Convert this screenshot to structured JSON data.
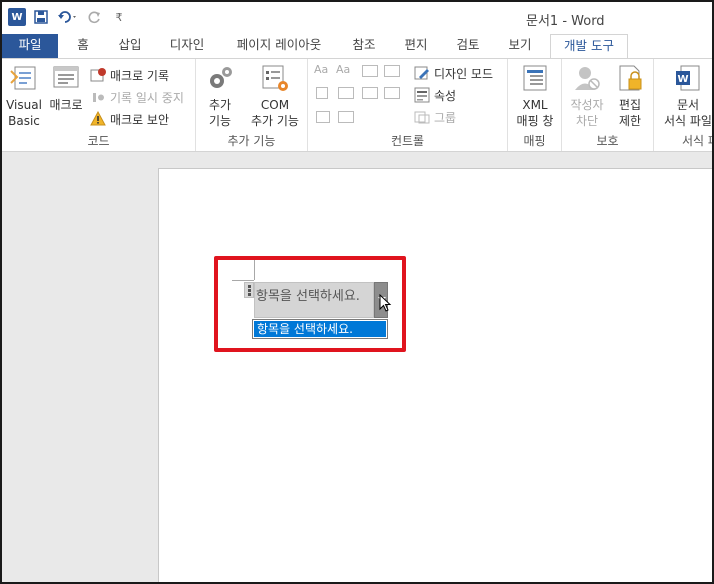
{
  "window": {
    "title": "문서1 - Word"
  },
  "qat": {
    "redo_more": "₹"
  },
  "tabs": [
    {
      "label": "파일"
    },
    {
      "label": "홈"
    },
    {
      "label": "삽입"
    },
    {
      "label": "디자인"
    },
    {
      "label": "페이지 레이아웃"
    },
    {
      "label": "참조"
    },
    {
      "label": "편지"
    },
    {
      "label": "검토"
    },
    {
      "label": "보기"
    },
    {
      "label": "개발 도구"
    }
  ],
  "ribbon": {
    "code": {
      "label": "코드",
      "visual_basic_1": "Visual",
      "visual_basic_2": "Basic",
      "macro": "매크로",
      "record_macro": "매크로 기록",
      "pause_recording": "기록 일시 중지",
      "macro_security": "매크로 보안"
    },
    "addins": {
      "label": "추가 기능",
      "addins_1": "추가",
      "addins_2": "기능",
      "com_1": "COM",
      "com_2": "추가 기능"
    },
    "controls": {
      "label": "컨트롤",
      "design_mode": "디자인 모드",
      "properties": "속성",
      "group": "그룹"
    },
    "mapping": {
      "label": "매핑",
      "xml_1": "XML",
      "xml_2": "매핑 창"
    },
    "protect": {
      "label": "보호",
      "block_authors_1": "작성자",
      "block_authors_2": "차단",
      "restrict_1": "편집",
      "restrict_2": "제한"
    },
    "templates": {
      "label": "서식 파",
      "doc_template_1": "문서",
      "doc_template_2": "서식 파일"
    }
  },
  "document": {
    "content_control_placeholder": "항목을 선택하세요.",
    "dropdown_items": [
      "항목을 선택하세요."
    ]
  },
  "colors": {
    "accent": "#2b579a",
    "highlight_border": "#e0141e",
    "selected_item": "#0078d7"
  }
}
